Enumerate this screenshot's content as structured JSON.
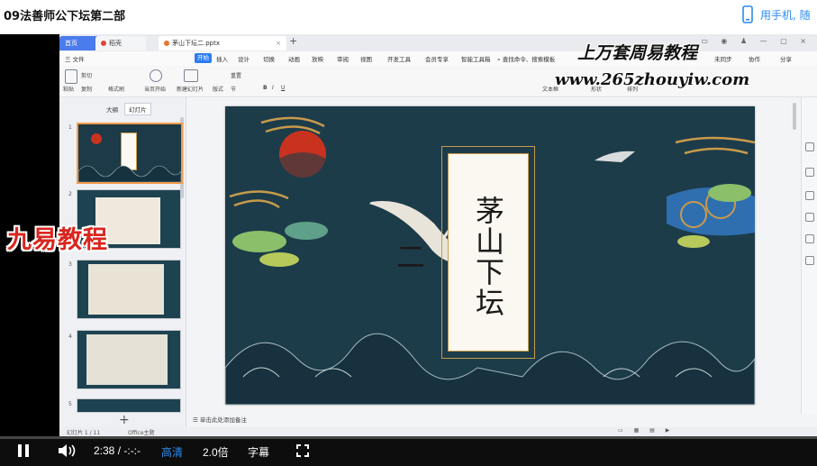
{
  "page": {
    "course_title": "09法善师公下坛第二部",
    "phone_link": "用手机, 随"
  },
  "app": {
    "tabs": {
      "home": "首页",
      "app": "稻壳",
      "file": "茅山下坛二.pptx"
    },
    "menu": [
      "三 文件",
      "开始",
      "插入",
      "设计",
      "切换",
      "动画",
      "放映",
      "审阅",
      "视图",
      "开发工具",
      "会员专享",
      "智能工具箱",
      "查找命令、搜索模板",
      "未同步",
      "协作",
      "分享"
    ],
    "active_menu_index": 1,
    "ribbon_labels": [
      "粘贴",
      "剪切",
      "复制",
      "格式刷",
      "当页开始",
      "新建幻灯片",
      "版式",
      "节",
      "重置",
      "B",
      "I",
      "U",
      "文本框",
      "形状",
      "排列"
    ],
    "panel_tabs": [
      "大纲",
      "幻灯片"
    ],
    "slide_numbers": [
      "1",
      "2",
      "3",
      "4",
      "5"
    ],
    "add_slide": "+",
    "notes_placeholder": "单击此处添加备注",
    "status_left": "幻灯片 1 / 11",
    "status_mid": "Office主题",
    "slide_title": "茅山下坛二"
  },
  "watermarks": {
    "line1": "上万套周易教程",
    "line2": "www.265zhouyiw.com",
    "jiuyi": "九易教程"
  },
  "player": {
    "time": "2:38 / -:-:-",
    "quality": "高清",
    "speed": "2.0倍",
    "subtitle": "字幕",
    "progress_percent": 0
  },
  "colors": {
    "accent": "#2d8cf0",
    "slide_bg": "#1d3c4a",
    "gold": "#c89b4a",
    "sun": "#c8321e",
    "jiuyi_red": "#d8261e"
  }
}
